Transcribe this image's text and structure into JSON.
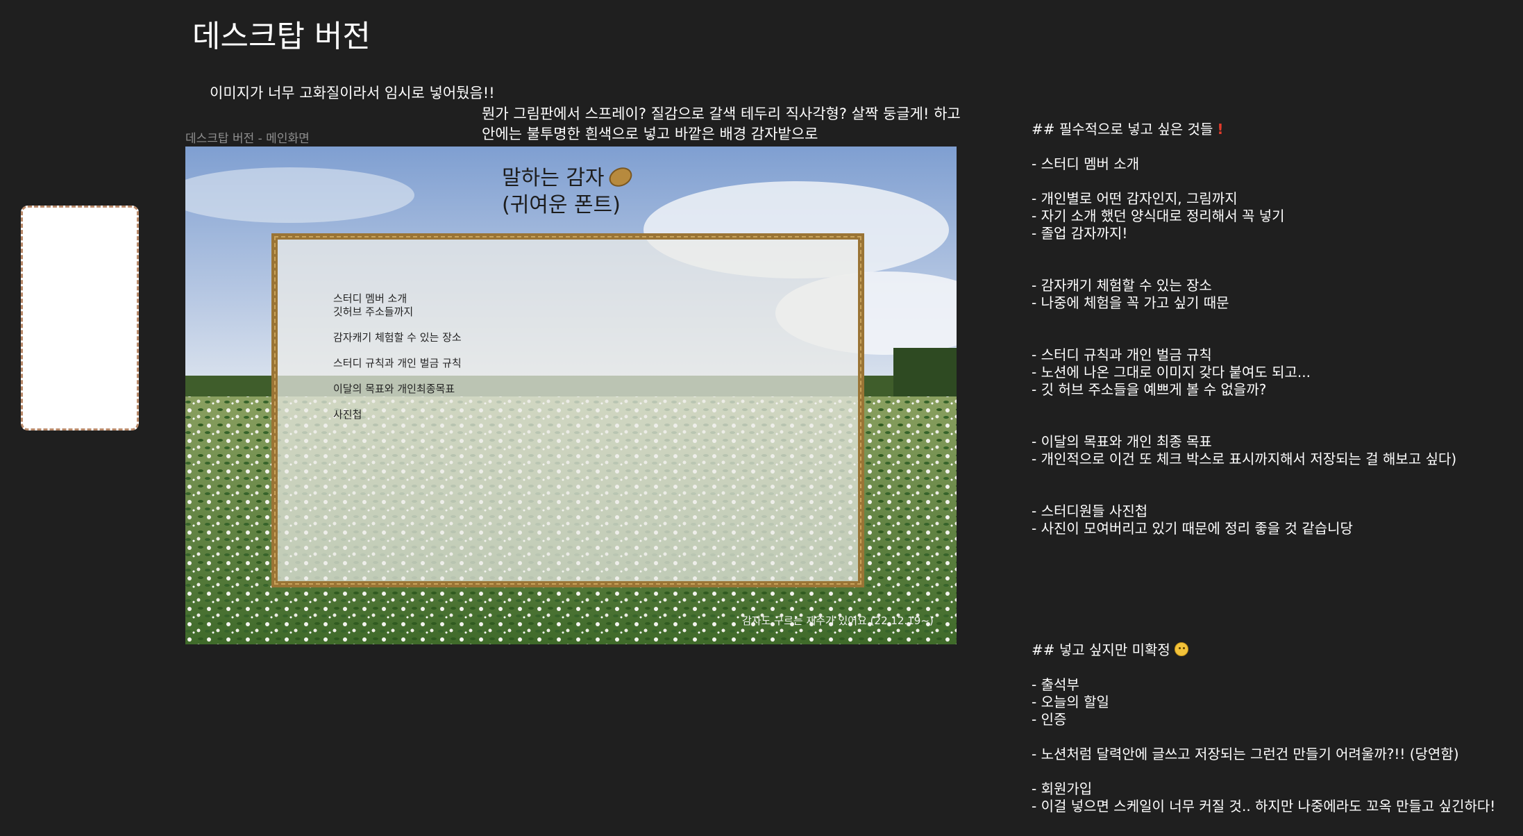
{
  "header": {
    "title": "데스크탑 버전",
    "temp_note": "이미지가 너무 고화질이라서 임시로 넣어뒀음!!",
    "design_note": "뭔가 그림판에서 스프레이? 질감으로 갈색 테두리 직사각형? 살짝 둥글게! 하고 안에는 불투명한 흰색으로 넣고 바깥은 배경 감자밭으로",
    "caption": "데스크탑 버전 - 메인화면"
  },
  "mockup": {
    "brand_line1": "말하는 감자",
    "brand_icon": "potato-icon",
    "brand_line2": "(귀여운 폰트)",
    "menu": [
      "스터디 멤버 소개",
      "깃허브 주소들까지",
      "감자캐기 체험할 수 있는 장소",
      "스터디 규칙과 개인 벌금 규칙",
      "이달의 목표와 개인최종목표",
      "사진첩"
    ],
    "footer": "감자도 구르는 재주가 있어요 (22.12.19~)"
  },
  "notes": {
    "required_heading": "## 필수적으로 넣고 싶은 것들",
    "required_icon": "exclamation-icon",
    "required": [
      "- 스터디 멤버 소개",
      "- 개인별로 어떤 감자인지, 그림까지",
      "- 자기 소개 했던 양식대로 정리해서 꼭 넣기",
      "- 졸업 감자까지!",
      "- 감자캐기 체험할 수 있는 장소",
      "- 나중에 체험을 꼭 가고 싶기 때문",
      "- 스터디 규칙과 개인 벌금 규칙",
      "- 노션에 나온 그대로 이미지 갖다 붙여도 되고...",
      "- 깃 허브 주소들을 예쁘게 볼 수 없을까?",
      "- 이달의 목표와 개인 최종 목표",
      "- 개인적으로 이건 또 체크 박스로 표시까지해서 저장되는 걸 해보고 싶다)",
      "- 스터디원들 사진첩",
      "- 사진이 모여버리고 있기 때문에 정리 좋을 것 같습니당"
    ],
    "optional_heading": "## 넣고 싶지만 미확정",
    "optional_icon": "thinking-face-icon",
    "optional": [
      "- 출석부",
      "- 오늘의 할일",
      "- 인증",
      "- 노션처럼 달력안에 글쓰고 저장되는 그런건 만들기 어려울까?!! (당연함)",
      "- 회원가입",
      "- 이걸 넣으면 스케일이 너무 커질 것.. 하지만 나중에라도 꼬옥 만들고 싶긴하다!"
    ]
  },
  "colors": {
    "background": "#1f1f1f",
    "frame_border": "#9a7435",
    "panel_fill": "rgba(236,236,232,0.72)"
  }
}
